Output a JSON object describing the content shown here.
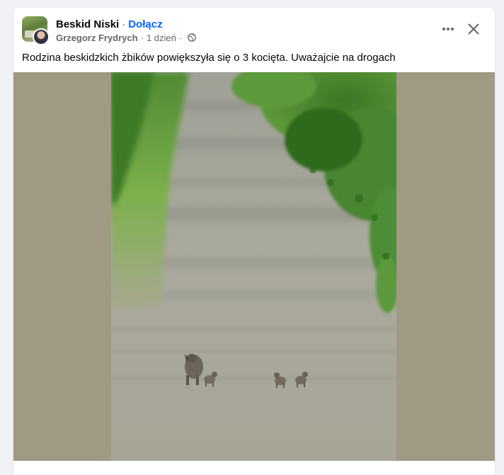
{
  "post": {
    "group_name": "Beskid Niski",
    "separator": "·",
    "join_label": "Dołącz",
    "author": "Grzegorz Frydrych",
    "time": "1 dzień",
    "caption": "Rodzina beskidzkich żbików powiększyła się o 3 kocięta. Uważajcie na drogach"
  },
  "icons": {
    "privacy": "globe-icon",
    "more": "more-horizontal-icon",
    "close": "close-icon"
  },
  "colors": {
    "link": "#0866ff",
    "text": "#050505",
    "secondary_text": "#65676b",
    "media_background": "#9f9a84"
  }
}
